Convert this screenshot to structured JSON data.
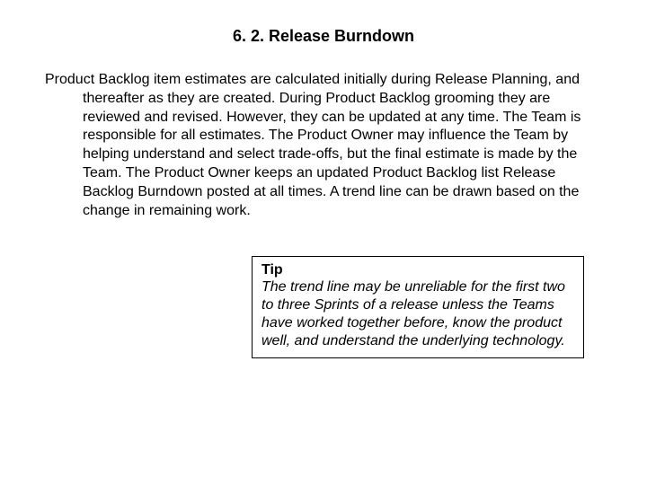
{
  "heading": "6. 2. Release Burndown",
  "body": "Product Backlog item estimates are calculated initially during Release Planning, and thereafter as they are created. During Product Backlog grooming they are reviewed and revised. However, they can be updated at any time. The Team is responsible for all estimates. The Product Owner may influence the Team by helping understand and select trade-offs, but the final estimate is made by the Team. The Product Owner keeps an updated Product Backlog list Release Backlog Burndown posted at all times. A trend line can be drawn based on the change in remaining work.",
  "tip": {
    "title": "Tip",
    "body": "The trend line may be unreliable for the first two to three Sprints of a release unless the Teams have worked together before, know the product well, and understand the underlying technology."
  }
}
